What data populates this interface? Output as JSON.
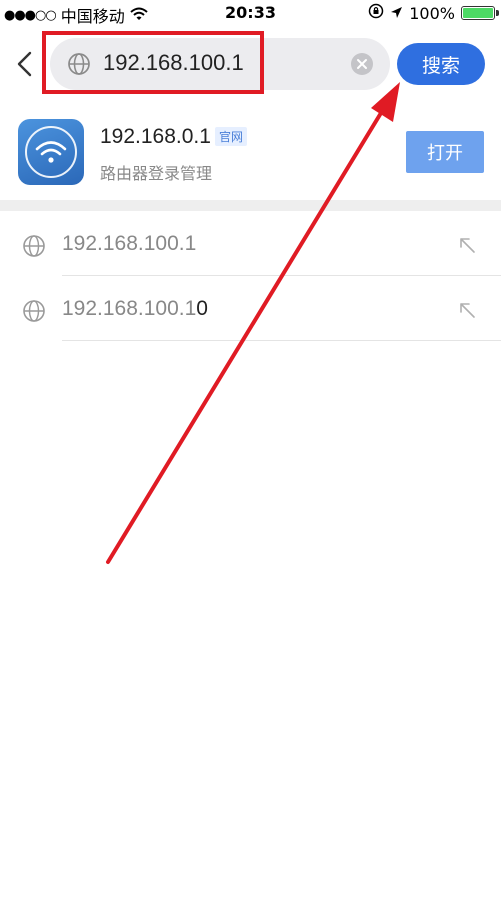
{
  "status_bar": {
    "signal": "●●●○○",
    "carrier": "中国移动",
    "time": "20:33",
    "battery_text": "100%",
    "battery_level": 1.0,
    "battery_color": "#4cd964"
  },
  "header": {
    "search_value": "192.168.100.1",
    "search_button_label": "搜索",
    "accent_color": "#2f6fe0",
    "highlight_color": "#e01b24"
  },
  "result_card": {
    "title": "192.168.0.1",
    "badge": "官网",
    "subtitle": "路由器登录管理",
    "open_button_label": "打开",
    "icon": "wifi-icon"
  },
  "suggestions": [
    {
      "text": "192.168.100.1",
      "typed_tail": ""
    },
    {
      "text": "192.168.100.1",
      "typed_tail": "0"
    }
  ],
  "icons": {
    "back": "back-chevron-icon",
    "globe": "globe-icon",
    "clear": "clear-icon",
    "fill": "fill-arrow-icon"
  }
}
